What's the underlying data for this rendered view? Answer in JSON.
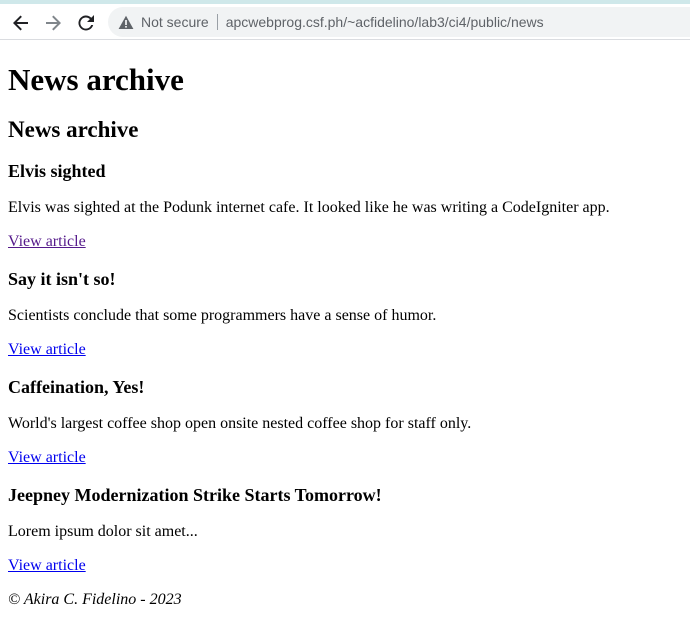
{
  "browser": {
    "security_label": "Not secure",
    "url": "apcwebprog.csf.ph/~acfidelino/lab3/ci4/public/news"
  },
  "page": {
    "heading": "News archive",
    "subheading": "News archive",
    "articles": [
      {
        "title": "Elvis sighted",
        "body": "Elvis was sighted at the Podunk internet cafe. It looked like he was writing a CodeIgniter app.",
        "link": "View article"
      },
      {
        "title": "Say it isn't so!",
        "body": "Scientists conclude that some programmers have a sense of humor.",
        "link": "View article"
      },
      {
        "title": "Caffeination, Yes!",
        "body": "World's largest coffee shop open onsite nested coffee shop for staff only.",
        "link": "View article"
      },
      {
        "title": "Jeepney Modernization Strike Starts Tomorrow!",
        "body": "Lorem ipsum dolor sit amet...",
        "link": "View article"
      }
    ],
    "footer": "© Akira C. Fidelino - 2023"
  },
  "colors": {
    "link": "#0000ee",
    "visited_link": "#551a8b",
    "omnibox_bg": "#f1f3f4"
  }
}
